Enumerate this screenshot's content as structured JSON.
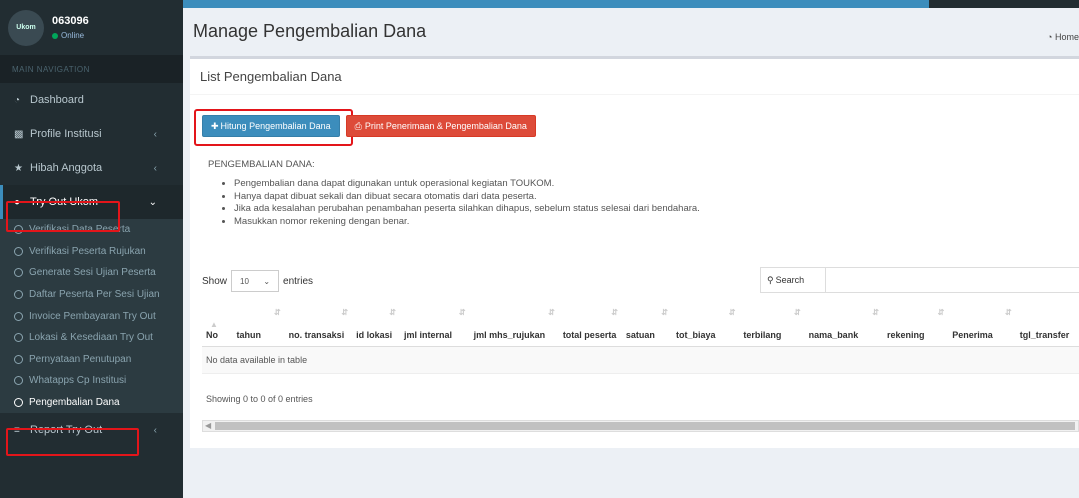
{
  "app": {
    "page_title": "Manage Pengembalian Dana",
    "breadcrumb": "Home"
  },
  "user": {
    "name": "063096",
    "status": "Online",
    "avatar_text": "Ukom"
  },
  "sidebar": {
    "header": "MAIN NAVIGATION",
    "items": [
      {
        "label": "Dashboard",
        "icon": "dashboard-icon",
        "chevron": false
      },
      {
        "label": "Profile Institusi",
        "icon": "building-icon",
        "chevron": true
      },
      {
        "label": "Hibah Anggota",
        "icon": "trophy-icon",
        "chevron": true
      },
      {
        "label": "Try Out Ukom",
        "icon": "circle-icon",
        "chevron": true,
        "active": true
      }
    ],
    "submenu": [
      "Verifikasi Data Peserta",
      "Verifikasi Peserta Rujukan",
      "Generate Sesi Ujian Peserta",
      "Daftar Peserta Per Sesi Ujian",
      "Invoice Pembayaran Try Out",
      "Lokasi & Kesediaan Try Out",
      "Pernyataan Penutupan",
      "Whatapps Cp Institusi",
      "Pengembalian Dana"
    ],
    "report": {
      "label": "Report Try Out",
      "icon": "list-icon"
    }
  },
  "box": {
    "title": "List Pengembalian Dana",
    "btn_hitung": "Hitung Pengembalian Dana",
    "btn_print": "Print Penerimaan & Pengembalian Dana",
    "info_title": "PENGEMBALIAN DANA:",
    "info_items": [
      "Pengembalian dana dapat digunakan untuk operasional kegiatan TOUKOM.",
      "Hanya dapat dibuat sekali dan dibuat secara otomatis dari data peserta.",
      "Jika ada kesalahan perubahan penambahan peserta silahkan dihapus, sebelum status selesai dari bendahara.",
      "Masukkan nomor rekening dengan benar."
    ]
  },
  "datatable": {
    "show_label": "Show",
    "length_value": "10",
    "entries_label": "entries",
    "search_label": "Search",
    "columns": [
      "No",
      "tahun",
      "no. transaksi",
      "id lokasi",
      "jml internal",
      "jml mhs_rujukan",
      "total peserta",
      "satuan",
      "tot_biaya",
      "terbilang",
      "nama_bank",
      "rekening",
      "Penerima",
      "tgl_transfer"
    ],
    "empty_text": "No data available in table",
    "info_text": "Showing 0 to 0 of 0 entries"
  },
  "colors": {
    "sidebar_bg": "#222d32",
    "primary": "#3c8dbc",
    "danger": "#dd4b39",
    "highlight": "#e3151a"
  }
}
